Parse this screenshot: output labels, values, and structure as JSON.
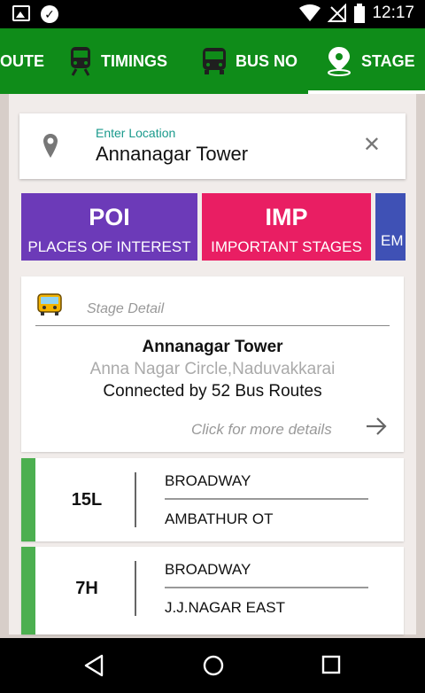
{
  "status_bar": {
    "time": "12:17"
  },
  "tabs": [
    {
      "label": "OUTE",
      "icon": "route-icon"
    },
    {
      "label": "TIMINGS",
      "icon": "train-icon"
    },
    {
      "label": "BUS NO",
      "icon": "bus-icon"
    },
    {
      "label": "STAGE",
      "icon": "location-pin-icon",
      "selected": true
    }
  ],
  "search": {
    "label": "Enter Location",
    "value": "Annanagar Tower"
  },
  "categories": [
    {
      "title": "POI",
      "subtitle": "PLACES OF INTEREST",
      "color": "#6c3ab8"
    },
    {
      "title": "IMP",
      "subtitle": "IMPORTANT STAGES",
      "color": "#e91e63"
    },
    {
      "title": "",
      "subtitle": "EM",
      "color": "#3f51b5"
    }
  ],
  "stage_detail": {
    "label": "Stage Detail",
    "name": "Annanagar Tower",
    "locality": "Anna Nagar Circle,Naduvakkarai",
    "routes_text": "Connected by 52 Bus Routes",
    "more_text": "Click for more details"
  },
  "routes": [
    {
      "number": "15L",
      "from": "BROADWAY",
      "to": "AMBATHUR OT"
    },
    {
      "number": "7H",
      "from": "BROADWAY",
      "to": "J.J.NAGAR EAST"
    }
  ],
  "colors": {
    "app_bar": "#0f8c19",
    "route_stripe": "#4caf50",
    "search_label": "#1a9a8c"
  }
}
